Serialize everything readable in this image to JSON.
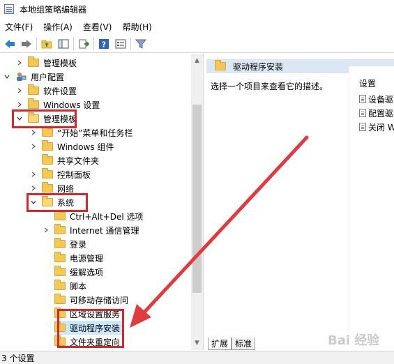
{
  "window": {
    "title": "本地组策略编辑器"
  },
  "menu": [
    "文件(F)",
    "操作(A)",
    "查看(V)",
    "帮助(H)"
  ],
  "toolbar": {
    "buttons": [
      "back-icon",
      "forward-icon",
      "up-folder-icon",
      "show-hide-tree-icon",
      "export-list-icon",
      "help-icon",
      "properties-icon",
      "filter-icon"
    ]
  },
  "tree": {
    "rows": [
      {
        "label": "管理模板"
      },
      {
        "label": "用户配置"
      },
      {
        "label": "软件设置"
      },
      {
        "label": "Windows 设置"
      },
      {
        "label": "管理模板"
      },
      {
        "label": "“开始”菜单和任务栏"
      },
      {
        "label": "Windows 组件"
      },
      {
        "label": "共享文件夹"
      },
      {
        "label": "控制面板"
      },
      {
        "label": "网络"
      },
      {
        "label": "系统"
      },
      {
        "label": "Ctrl+Alt+Del 选项"
      },
      {
        "label": "Internet 通信管理"
      },
      {
        "label": "登录"
      },
      {
        "label": "电源管理"
      },
      {
        "label": "缓解选项"
      },
      {
        "label": "脚本"
      },
      {
        "label": "可移动存储访问"
      },
      {
        "label": "区域设置服务"
      },
      {
        "label": "驱动程序安装"
      },
      {
        "label": "文件夹重定向"
      }
    ]
  },
  "right": {
    "header": "驱动程序安装",
    "description": "选择一个项目来查看它的描述。",
    "column_header": "设置",
    "items": [
      "设备驱",
      "配置驱",
      "关闭 W"
    ]
  },
  "tabs": [
    "扩展",
    "标准"
  ],
  "status": {
    "text": "3 个设置"
  },
  "watermark": "Bai 经验",
  "colors": {
    "highlight": "#d9262d",
    "selected": "#cce8ff",
    "header_bg": "#dbe7f5"
  }
}
